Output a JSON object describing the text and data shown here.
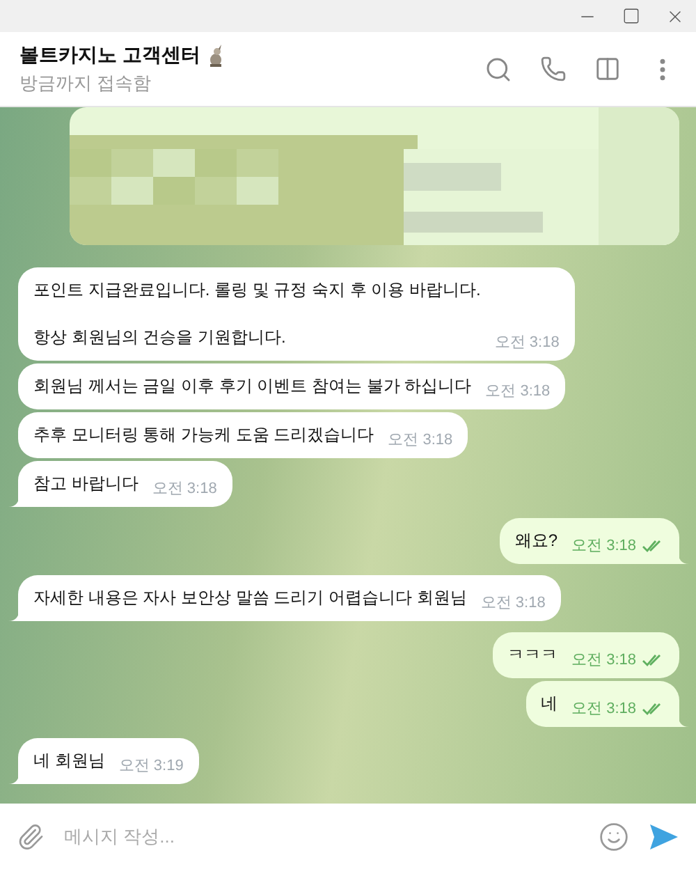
{
  "header": {
    "title": "볼트카지노 고객센터",
    "status": "방금까지 접속함"
  },
  "messages": [
    {
      "kind": "picture",
      "outgoing": true
    },
    {
      "kind": "text",
      "outgoing": false,
      "text": "포인트 지급완료입니다. 롤링 및 규정 숙지 후 이용 바랍니다.\n\n항상 회원님의 건승을 기원합니다.",
      "time": "오전 3:18",
      "tail": false
    },
    {
      "kind": "text",
      "outgoing": false,
      "text": "회원님 께서는 금일 이후 후기 이벤트 참여는 불가 하십니다",
      "time": "오전 3:18",
      "tail": false
    },
    {
      "kind": "text",
      "outgoing": false,
      "text": "추후 모니터링 통해 가능케 도움 드리겠습니다",
      "time": "오전 3:18",
      "tail": false
    },
    {
      "kind": "text",
      "outgoing": false,
      "text": "참고 바랍니다",
      "time": "오전 3:18",
      "tail": true
    },
    {
      "kind": "text",
      "outgoing": true,
      "text": "왜요?",
      "time": "오전 3:18",
      "tail": true,
      "read": true
    },
    {
      "kind": "text",
      "outgoing": false,
      "text": "자세한 내용은 자사 보안상 말씀 드리기 어렵습니다 회원님",
      "time": "오전 3:18",
      "tail": true
    },
    {
      "kind": "text",
      "outgoing": true,
      "text": "ㅋㅋㅋ",
      "time": "오전 3:18",
      "tail": false,
      "read": true
    },
    {
      "kind": "text",
      "outgoing": true,
      "text": "네",
      "time": "오전 3:18",
      "tail": true,
      "read": true
    },
    {
      "kind": "text",
      "outgoing": false,
      "text": "네 회원님",
      "time": "오전 3:19",
      "tail": true
    }
  ],
  "composer": {
    "placeholder": "메시지 작성..."
  }
}
